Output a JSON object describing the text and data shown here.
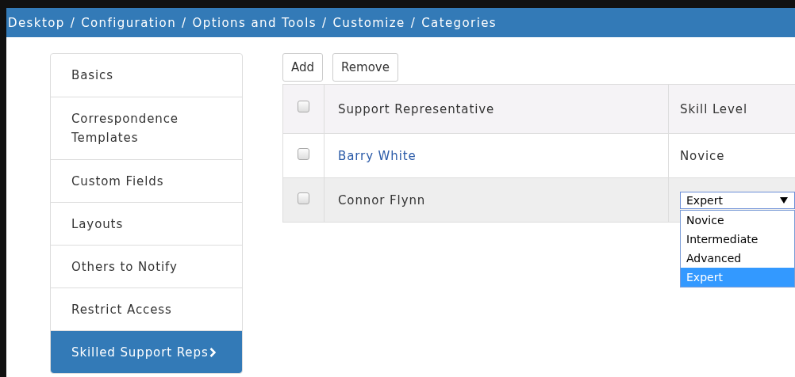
{
  "breadcrumb": [
    "Desktop",
    "Configuration",
    "Options and Tools",
    "Customize",
    "Categories"
  ],
  "breadcrumb_separator": "/",
  "sidebar": {
    "items": [
      {
        "label": "Basics",
        "selected": false
      },
      {
        "label": "Correspondence Templates",
        "selected": false
      },
      {
        "label": "Custom Fields",
        "selected": false
      },
      {
        "label": "Layouts",
        "selected": false
      },
      {
        "label": "Others to Notify",
        "selected": false
      },
      {
        "label": "Restrict Access",
        "selected": false
      },
      {
        "label": "Skilled Support Reps",
        "selected": true
      }
    ]
  },
  "toolbar": {
    "buttons": [
      "Add",
      "Remove"
    ]
  },
  "table": {
    "columns": [
      "Support Representative",
      "Skill Level"
    ],
    "header_checked": false,
    "rows": [
      {
        "checked": false,
        "name": "Barry White",
        "link": true,
        "skill": "Novice",
        "editing": false
      },
      {
        "checked": false,
        "name": "Connor Flynn",
        "link": false,
        "skill": "Expert",
        "editing": true,
        "expanded": true,
        "options": [
          {
            "label": "Novice",
            "selected": false
          },
          {
            "label": "Intermediate",
            "selected": false
          },
          {
            "label": "Advanced",
            "selected": false
          },
          {
            "label": "Expert",
            "selected": true
          }
        ]
      }
    ]
  }
}
